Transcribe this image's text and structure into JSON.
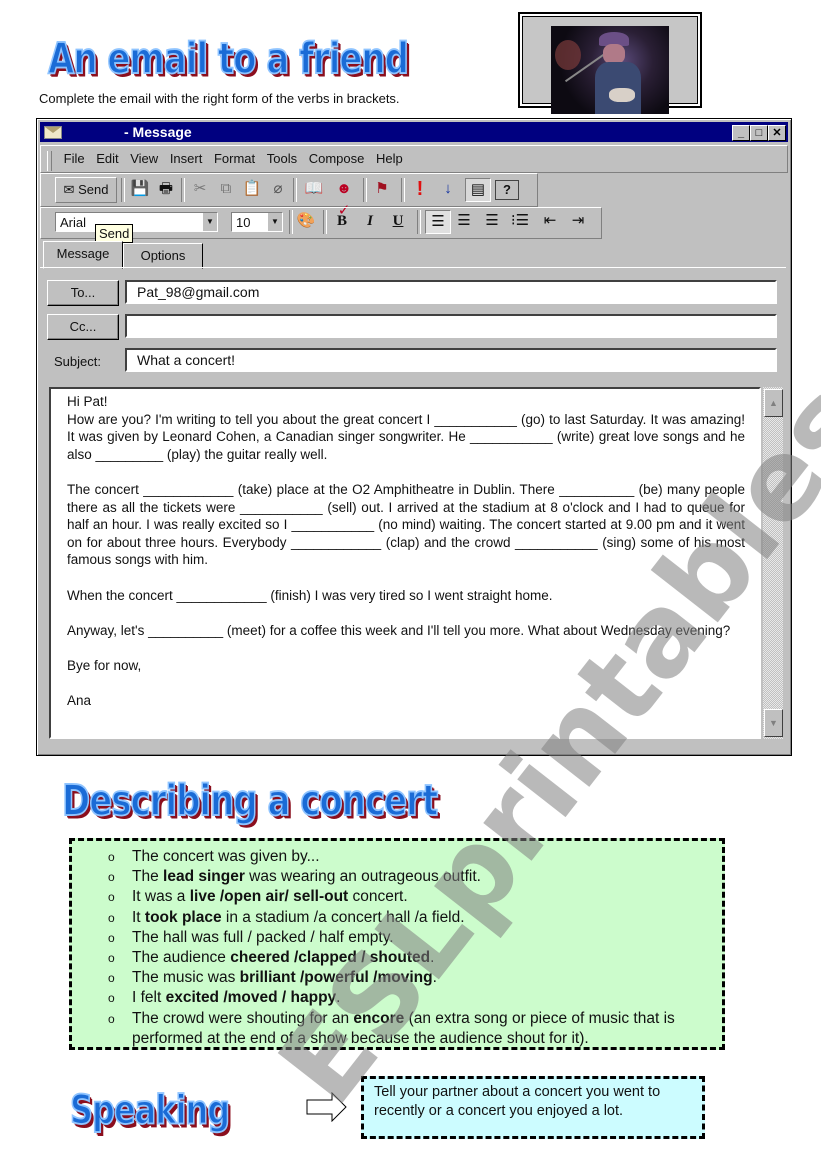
{
  "header": {
    "title": "An email to a friend",
    "instruction": "Complete the email with the right form of the verbs in brackets."
  },
  "photo": {
    "icon": "concert-photo",
    "description": "Singer with hat playing guitar on stage"
  },
  "window": {
    "title": "- Message",
    "controls": {
      "minimize": "_",
      "maximize": "□",
      "close": "✕"
    },
    "menu": [
      "File",
      "Edit",
      "View",
      "Insert",
      "Format",
      "Tools",
      "Compose",
      "Help"
    ],
    "toolbar": {
      "send_label": "Send",
      "icons": [
        "save-icon",
        "print-icon",
        "cut-icon",
        "copy-icon",
        "paste-icon",
        "attach-icon",
        "address-book-icon",
        "check-names-icon",
        "flag-icon",
        "high-importance-icon",
        "low-importance-icon",
        "message-options-icon",
        "help-icon"
      ]
    },
    "format_bar": {
      "font": "Arial",
      "size": "10",
      "bold": "B",
      "italic": "I",
      "underline": "U"
    },
    "tooltip": "Send",
    "tabs": [
      "Message",
      "Options"
    ],
    "fields": {
      "to_button": "To...",
      "to_value": "Pat_98@gmail.com",
      "cc_button": "Cc...",
      "cc_value": "",
      "subject_label": "Subject:",
      "subject_value": "What a concert!"
    },
    "body": {
      "greeting": "Hi Pat!",
      "p1": "How are you? I'm writing to tell you about the great concert I ___________ (go) to last Saturday. It was amazing! It was given by Leonard Cohen, a Canadian singer songwriter. He ___________ (write) great love songs and he also _________ (play) the guitar really well.",
      "p2": "The concert ____________ (take) place at the O2 Amphitheatre in Dublin. There __________ (be) many people there as all the tickets were ___________ (sell) out. I arrived at the stadium at 8 o'clock and I had to queue for half an hour. I was really excited so I ___________ (no mind) waiting. The concert started at 9.00 pm and it went on for about three hours. Everybody ____________ (clap) and the crowd ___________ (sing) some of his most famous songs with him.",
      "p3": "When the concert ____________ (finish) I was very tired so I went straight home.",
      "p4": "Anyway, let's __________ (meet) for a coffee this week and I'll tell you more. What about Wednesday evening?",
      "p5": "Bye for now,",
      "signature": "Ana"
    }
  },
  "describing": {
    "title": "Describing a concert",
    "items": [
      [
        {
          "t": "The concert was given by..."
        }
      ],
      [
        {
          "t": "The "
        },
        {
          "b": "lead singer"
        },
        {
          "t": " was wearing an outrageous outfit."
        }
      ],
      [
        {
          "t": "It was a "
        },
        {
          "b": "live /open air/ sell-out"
        },
        {
          "t": " concert."
        }
      ],
      [
        {
          "t": "It "
        },
        {
          "b": "took place"
        },
        {
          "t": " in a stadium /a concert hall /a field."
        }
      ],
      [
        {
          "t": "The hall was full / packed / half empty."
        }
      ],
      [
        {
          "t": "The audience "
        },
        {
          "b": "cheered /clapped / shouted"
        },
        {
          "t": "."
        }
      ],
      [
        {
          "t": "The music was "
        },
        {
          "b": "brilliant /powerful /moving"
        },
        {
          "t": "."
        }
      ],
      [
        {
          "t": "I felt "
        },
        {
          "b": "excited /moved / happy"
        },
        {
          "t": "."
        }
      ],
      [
        {
          "t": "The crowd were shouting for an "
        },
        {
          "b": "encore"
        },
        {
          "t": " (an extra song or piece of music that is performed at the end of a show because the audience shout for it)."
        }
      ]
    ]
  },
  "speaking": {
    "title": "Speaking",
    "prompt": "Tell your partner about a concert you went to recently or a concert you enjoyed a lot."
  },
  "watermark": "ESLprintables.com",
  "colors": {
    "title_blue": "#1a6bd6",
    "title_shadow": "#8b0f1e",
    "list_bg": "#ccfccc",
    "speak_bg": "#ccfcff",
    "titlebar": "#000080"
  }
}
